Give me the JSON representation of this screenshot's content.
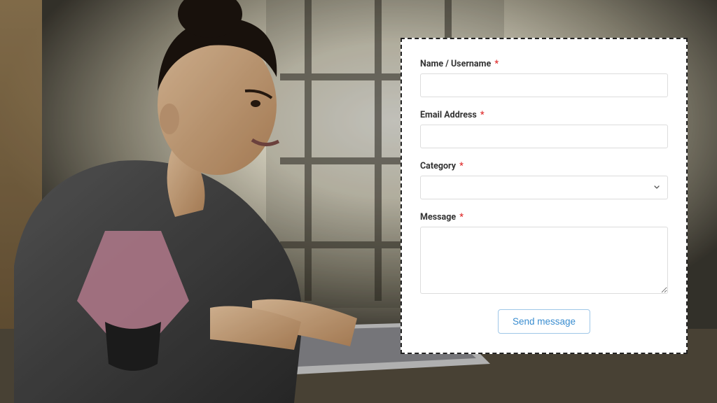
{
  "form": {
    "name": {
      "label": "Name / Username",
      "required_mark": "*",
      "value": ""
    },
    "email": {
      "label": "Email Address",
      "required_mark": "*",
      "value": ""
    },
    "category": {
      "label": "Category",
      "required_mark": "*",
      "selected": ""
    },
    "message": {
      "label": "Message",
      "required_mark": "*",
      "value": ""
    },
    "submit_label": "Send message"
  },
  "colors": {
    "required": "#e03131",
    "button_text": "#3a8dd0",
    "button_border": "#9fc7e8",
    "input_border": "#dcdcdc"
  }
}
